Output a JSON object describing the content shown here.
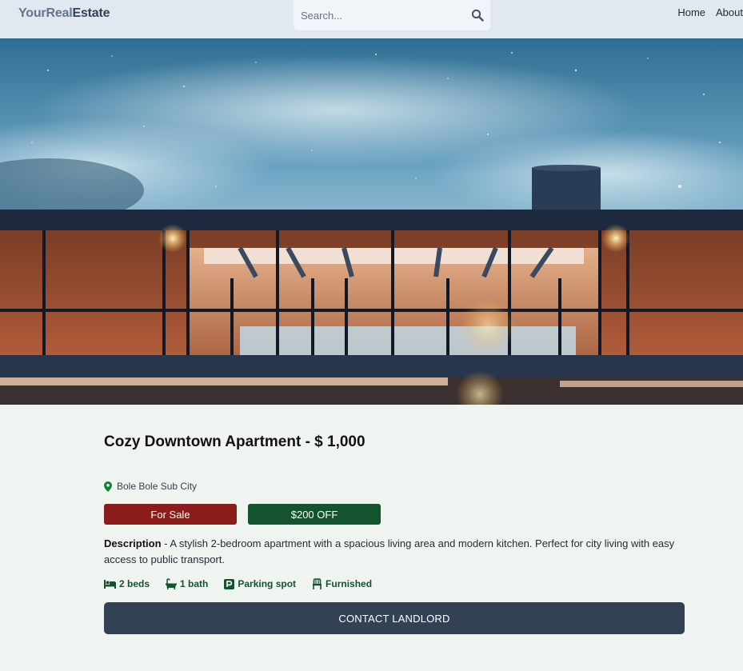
{
  "header": {
    "brand_part1": "YourReal",
    "brand_part2": "Estate",
    "search_placeholder": "Search...",
    "search_icon": "magnifier-icon",
    "nav": [
      "Home",
      "About"
    ]
  },
  "listing": {
    "title": "Cozy Downtown Apartment - $ 1,000",
    "location": "Bole Bole Sub City",
    "location_icon": "map-pin-icon",
    "status_badge": "For Sale",
    "discount_badge": "$200 OFF",
    "description_label": "Description",
    "description_text": " - A stylish 2-bedroom apartment with a spacious living area and modern kitchen. Perfect for city living with easy access to public transport.",
    "features": [
      {
        "icon": "bed-icon",
        "label": "2 beds"
      },
      {
        "icon": "bathtub-icon",
        "label": "1 bath"
      },
      {
        "icon": "parking-icon",
        "label": "Parking spot"
      },
      {
        "icon": "chair-icon",
        "label": "Furnished"
      }
    ],
    "contact_button": "CONTACT LANDLORD"
  },
  "colors": {
    "navbar_bg": "#e2e8f0",
    "page_bg": "#f0f4f0",
    "sale_badge": "#8b1c1c",
    "discount_badge": "#14532d",
    "feature_text": "#14532d",
    "button_bg": "#334155"
  }
}
